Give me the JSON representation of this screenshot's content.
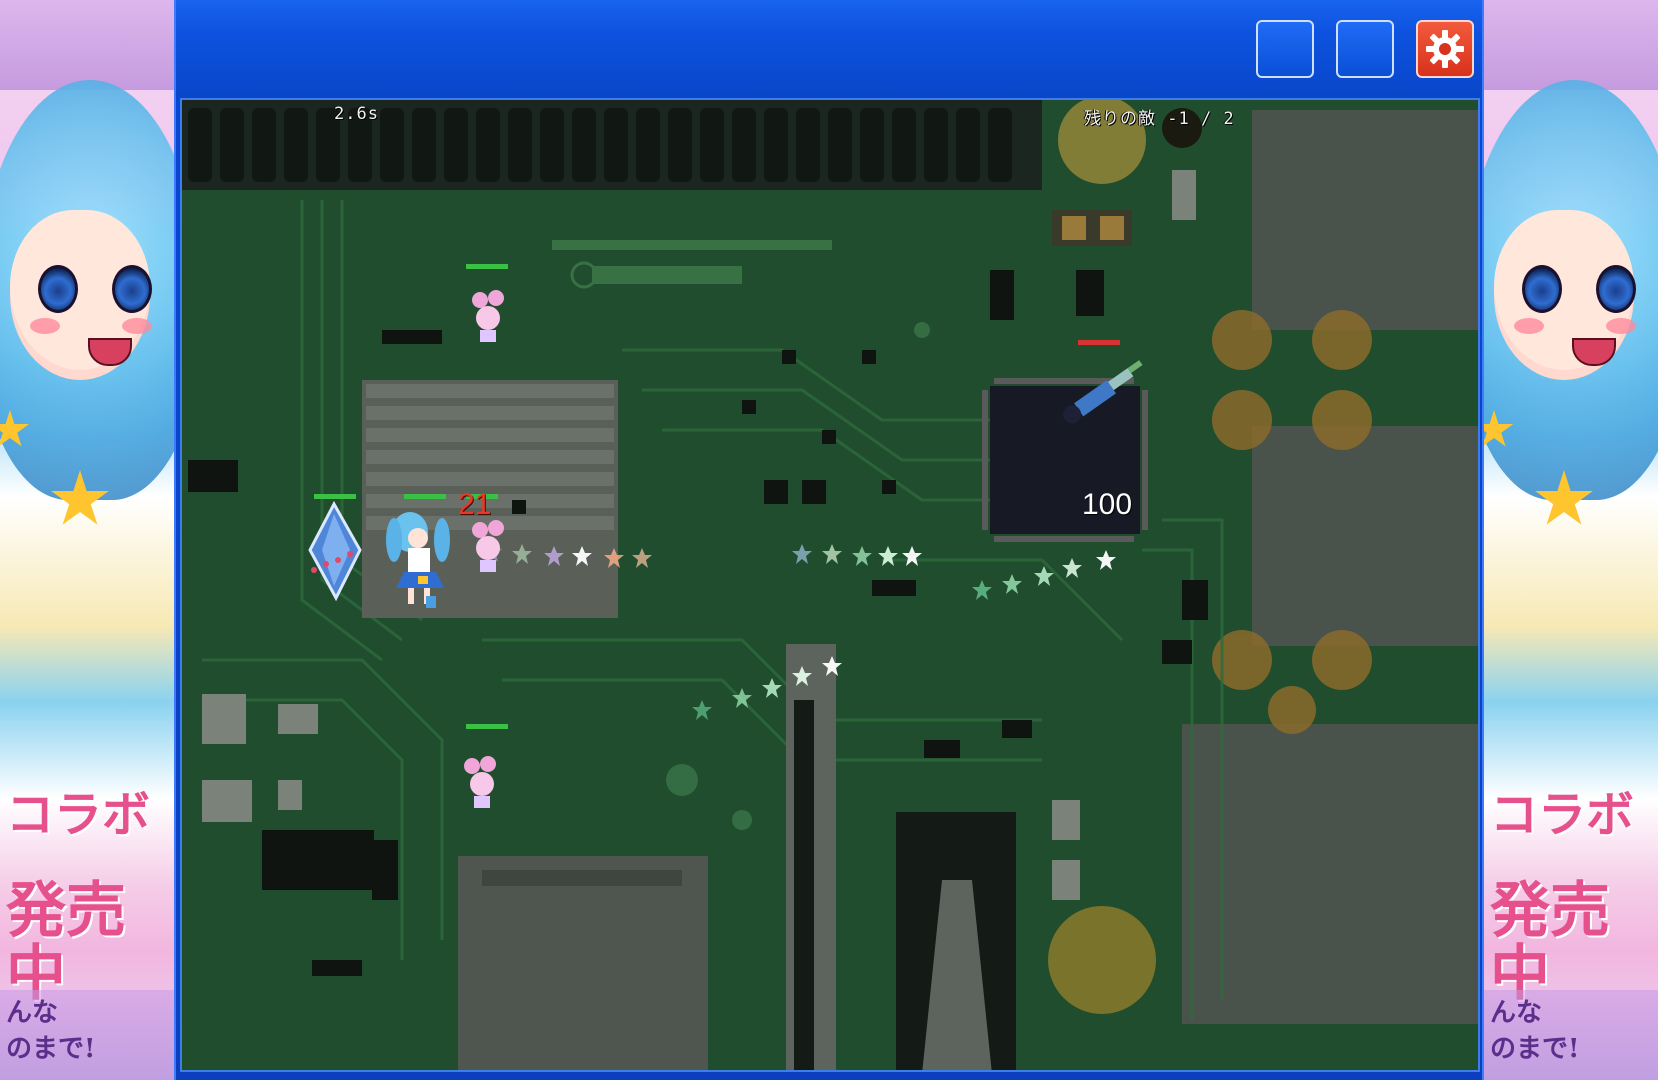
{
  "window": {
    "buttons": [
      {
        "name": "window-button-1",
        "label": ""
      },
      {
        "name": "window-button-2",
        "label": ""
      },
      {
        "name": "settings-button",
        "icon": "gear-icon"
      }
    ],
    "accent_color": "#0a4fd6",
    "settings_color": "#d8321c"
  },
  "hud": {
    "elapsed_time": "2.6s",
    "enemies_remaining": "残りの敵 -1 / 2"
  },
  "combat": {
    "damage_number": "21",
    "chip_counter": "100"
  },
  "side_art": {
    "left_text_lines": [
      "コラボ",
      "発売中"
    ],
    "right_text_lines": [
      "コラボ",
      "発売中"
    ],
    "bottom_text_lines": [
      "んな",
      "のまで!"
    ]
  },
  "colors": {
    "hp_bar": "#39c045",
    "enemy_hp_bar": "#d83232",
    "damage_text": "#e53a2a",
    "pcb": "#1e4a2c"
  }
}
